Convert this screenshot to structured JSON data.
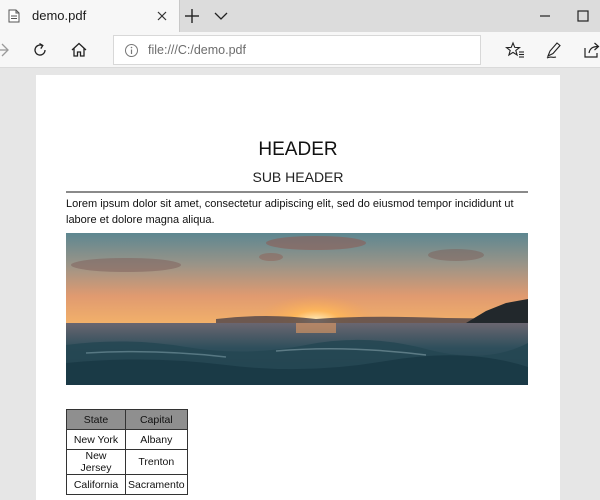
{
  "browser": {
    "tab": {
      "title": "demo.pdf"
    },
    "address_bar": {
      "url": "file:///C:/demo.pdf"
    }
  },
  "document": {
    "header": "HEADER",
    "subheader": "SUB HEADER",
    "paragraph": "Lorem ipsum dolor sit amet, consectetur adipiscing elit, sed do eiusmod tempor incididunt ut labore et dolore magna aliqua.",
    "table": {
      "columns": [
        "State",
        "Capital"
      ],
      "rows": [
        [
          "New York",
          "Albany"
        ],
        [
          "New Jersey",
          "Trenton"
        ],
        [
          "California",
          "Sacramento"
        ]
      ]
    }
  }
}
